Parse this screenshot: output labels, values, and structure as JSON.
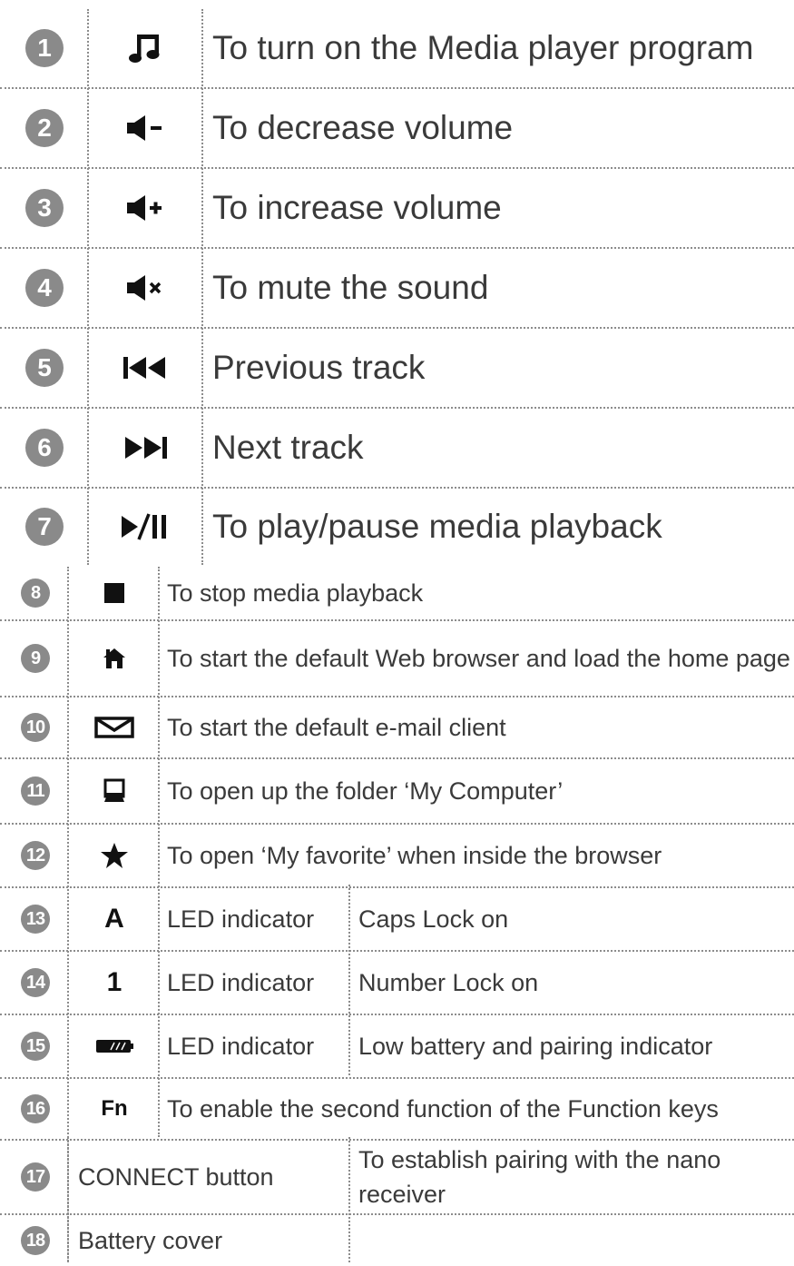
{
  "top_rows": [
    {
      "num": "1",
      "icon": "music-note-icon",
      "text": "To turn on the Media player program"
    },
    {
      "num": "2",
      "icon": "volume-down-icon",
      "text": "To decrease volume"
    },
    {
      "num": "3",
      "icon": "volume-up-icon",
      "text": "To increase volume"
    },
    {
      "num": "4",
      "icon": "volume-mute-icon",
      "text": "To mute the sound"
    },
    {
      "num": "5",
      "icon": "previous-track-icon",
      "text": "Previous track"
    },
    {
      "num": "6",
      "icon": "next-track-icon",
      "text": "Next track"
    },
    {
      "num": "7",
      "icon": "play-pause-icon",
      "text": "To play/pause media playback"
    }
  ],
  "bottom_rows": [
    {
      "num": "8",
      "icon": "stop-icon",
      "text": "To stop media playback"
    },
    {
      "num": "9",
      "icon": "home-icon",
      "text": "To start the default Web browser and load the home page"
    },
    {
      "num": "10",
      "icon": "mail-icon",
      "text": "To start the default e-mail client"
    },
    {
      "num": "11",
      "icon": "computer-icon",
      "text": "To open up the folder ‘My Computer’"
    },
    {
      "num": "12",
      "icon": "star-icon",
      "text": "To open ‘My favorite’ when inside the browser"
    },
    {
      "num": "13",
      "icon_text": "A",
      "label": "LED indicator",
      "desc": "Caps Lock on"
    },
    {
      "num": "14",
      "icon_text": "1",
      "label": "LED indicator",
      "desc": "Number Lock on"
    },
    {
      "num": "15",
      "icon": "battery-icon",
      "label": "LED indicator",
      "desc": "Low battery and pairing indicator"
    },
    {
      "num": "16",
      "icon_text": "Fn",
      "text": "To enable the second function of the Function keys"
    },
    {
      "num": "17",
      "label": "CONNECT button",
      "desc": "To establish pairing with the nano receiver"
    },
    {
      "num": "18",
      "label": "Battery cover",
      "desc": ""
    }
  ]
}
